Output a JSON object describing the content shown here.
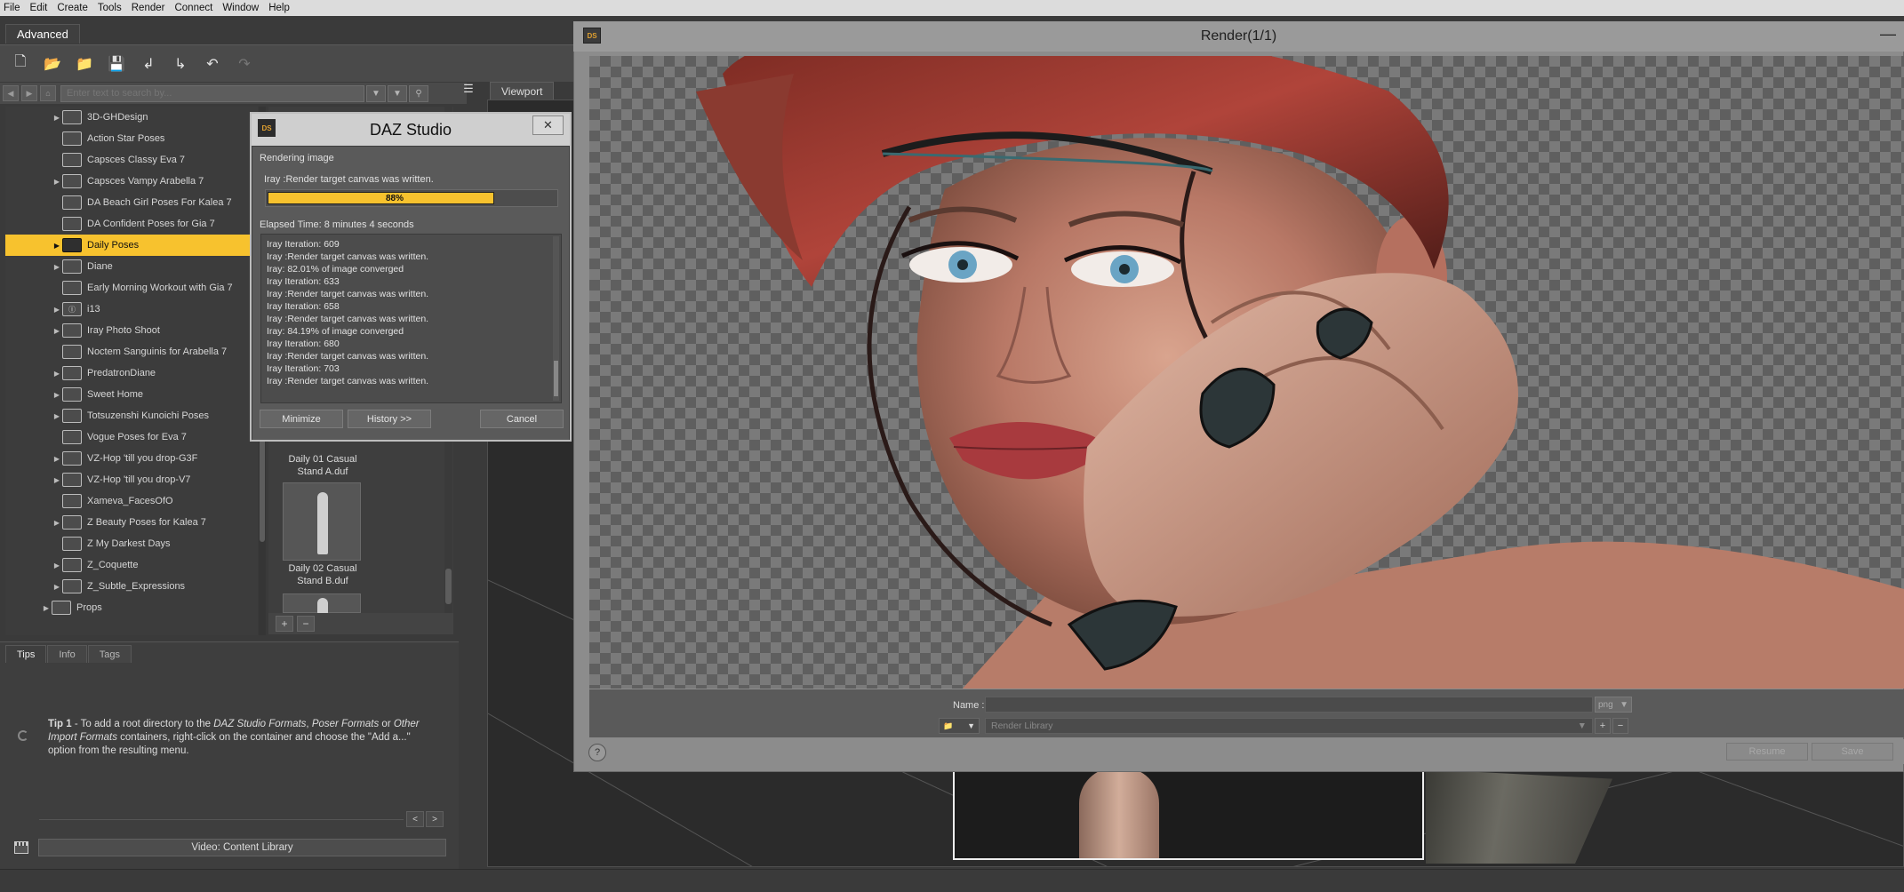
{
  "menubar": [
    "File",
    "Edit",
    "Create",
    "Tools",
    "Render",
    "Connect",
    "Window",
    "Help"
  ],
  "activity_tab": "Advanced",
  "search": {
    "placeholder": "Enter text to search by..."
  },
  "tree": [
    {
      "label": "3D-GHDesign",
      "arrow": true,
      "icon": "3dgh-logo-icon"
    },
    {
      "label": "Action Star Poses",
      "arrow": false
    },
    {
      "label": "Capsces Classy Eva 7",
      "arrow": false
    },
    {
      "label": "Capsces Vampy Arabella 7",
      "arrow": true
    },
    {
      "label": "DA Beach Girl Poses For Kalea 7",
      "arrow": false
    },
    {
      "label": "DA Confident Poses for Gia 7",
      "arrow": false
    },
    {
      "label": "Daily Poses",
      "arrow": true,
      "selected": true
    },
    {
      "label": "Diane",
      "arrow": true
    },
    {
      "label": "Early Morning Workout with Gia 7",
      "arrow": false
    },
    {
      "label": "i13",
      "arrow": true,
      "icon": "i13-logo-icon"
    },
    {
      "label": "Iray Photo Shoot",
      "arrow": true
    },
    {
      "label": "Noctem Sanguinis for Arabella 7",
      "arrow": false
    },
    {
      "label": "PredatronDiane",
      "arrow": true
    },
    {
      "label": "Sweet Home",
      "arrow": true
    },
    {
      "label": "Totsuzenshi Kunoichi Poses",
      "arrow": true
    },
    {
      "label": "Vogue Poses for Eva 7",
      "arrow": false
    },
    {
      "label": "VZ-Hop 'till you drop-G3F",
      "arrow": true
    },
    {
      "label": "VZ-Hop 'till you drop-V7",
      "arrow": true
    },
    {
      "label": "Xameva_FacesOfO",
      "arrow": false
    },
    {
      "label": "Z Beauty Poses for Kalea 7",
      "arrow": true
    },
    {
      "label": "Z My Darkest Days",
      "arrow": false
    },
    {
      "label": "Z_Coquette",
      "arrow": true
    },
    {
      "label": "Z_Subtle_Expressions",
      "arrow": true
    },
    {
      "label": "Props",
      "arrow": true,
      "indent": -1
    }
  ],
  "thumbnails": [
    {
      "label1": "Daily 01 Casual",
      "label2": "Stand A.duf"
    },
    {
      "label1": "Daily 02 Casual",
      "label2": "Stand B.duf"
    }
  ],
  "tips": {
    "tabs": [
      "Tips",
      "Info",
      "Tags"
    ],
    "active_tab": "Tips",
    "tip_prefix": "Tip 1",
    "tip_part1": " - To add a root directory to the ",
    "tip_em1": "DAZ Studio Formats",
    "tip_part2": ", ",
    "tip_em2": "Poser Formats",
    "tip_part3": " or ",
    "tip_em3": "Other Import Formats",
    "tip_part4": " containers, right-click on the container and choose the \"Add a...\" option from the resulting menu.",
    "video_button": "Video: Content Library"
  },
  "viewport": {
    "tab": "Viewport"
  },
  "render_window": {
    "title": "Render(1/1)",
    "logo": "DS",
    "name_label": "Name :",
    "ext_value": "png",
    "library_value": "Render Library",
    "resume_button": "Resume",
    "save_button": "Save",
    "help": "?"
  },
  "progress_dialog": {
    "logo": "DS",
    "title": "DAZ Studio",
    "status": "Rendering image",
    "substatus": "Iray :Render target canvas was written.",
    "percent": 0.88,
    "percent_text": "88%",
    "elapsed": "Elapsed Time:  8 minutes 4 seconds",
    "log": [
      "Iray Iteration: 609",
      "Iray :Render target canvas was written.",
      "Iray: 82.01% of image converged",
      "Iray Iteration: 633",
      "Iray :Render target canvas was written.",
      "Iray Iteration: 658",
      "Iray :Render target canvas was written.",
      "Iray: 84.19% of image converged",
      "Iray Iteration: 680",
      "Iray :Render target canvas was written.",
      "Iray Iteration: 703",
      "Iray :Render target canvas was written."
    ],
    "buttons": {
      "minimize": "Minimize",
      "history": "History >>",
      "cancel": "Cancel"
    }
  },
  "colors": {
    "accent": "#f7c22e",
    "panel": "#3e3e3e",
    "menubar": "#dcdcdc"
  }
}
